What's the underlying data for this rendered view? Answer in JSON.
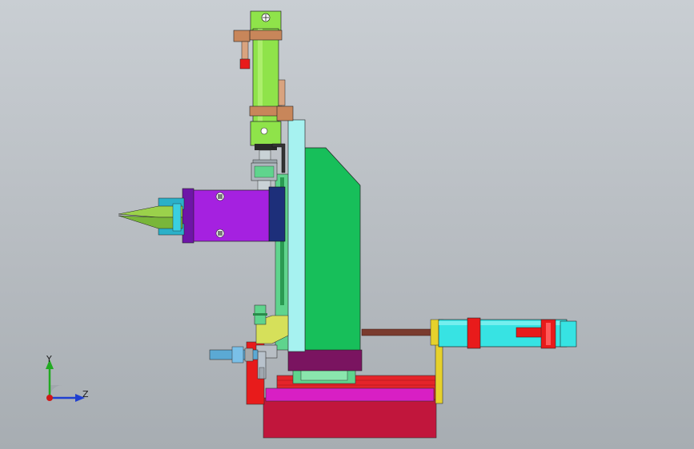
{
  "viewport": {
    "background_top": "#c9ced3",
    "background_bottom": "#a7adb2"
  },
  "triad": {
    "y_label": "Y",
    "z_label": "Z",
    "y_color": "#22aa22",
    "z_color": "#1f3fd1",
    "x_color": "#d01818"
  },
  "colors": {
    "cylinder_green": "#8fe34a",
    "clamp_copper": "#c8865a",
    "base_block": "#17bf5a",
    "base_plate_face": "#a6f2f0",
    "gripper_body": "#a521e0",
    "gripper_finger": "#9bd14b",
    "cyan_cylinder": "#37e3e3",
    "red_part": "#e81b1b",
    "rod_brown": "#7a3b2e",
    "bottom_block": "#c1163c",
    "magenta_plate": "#d81fc4",
    "yellow_bracket": "#e6d12c",
    "dark_purple": "#7a1460"
  }
}
